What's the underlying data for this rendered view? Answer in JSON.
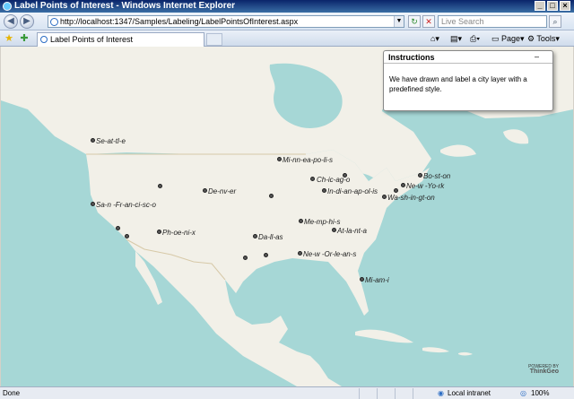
{
  "window": {
    "title": "Label Points of Interest - Windows Internet Explorer"
  },
  "address": {
    "url": "http://localhost:1347/Samples/Labeling/LabelPointsOfInterest.aspx"
  },
  "search": {
    "placeholder": "Live Search"
  },
  "tab": {
    "label": "Label Points of Interest"
  },
  "commands": {
    "page": "Page",
    "tools": "Tools"
  },
  "instructions": {
    "title": "Instructions",
    "minimize": "–",
    "body": "We have drawn and label a city layer with a predefined style."
  },
  "cities": [
    {
      "label": "Se-at-tl-e"
    },
    {
      "label": "Mi-nn-ea-po-li-s"
    },
    {
      "label": "Ch-ic-ag-o"
    },
    {
      "label": "Bo-st-on"
    },
    {
      "label": "Ne-w -Yo-rk"
    },
    {
      "label": "Wa-sh-in-gt-on"
    },
    {
      "label": "De-nv-er"
    },
    {
      "label": "In-di-an-ap-ol-is"
    },
    {
      "label": "Sa-n -Fr-an-ci-sc-o"
    },
    {
      "label": "Me-mp-hi-s"
    },
    {
      "label": "At-la-nt-a"
    },
    {
      "label": "Ph-oe-ni-x"
    },
    {
      "label": "Da-ll-as"
    },
    {
      "label": "Ne-w -Or-le-an-s"
    },
    {
      "label": "Mi-am-i"
    }
  ],
  "branding": {
    "powered_by": "POWERED BY",
    "company": "ThinkGeo"
  },
  "statusbar": {
    "left": "Done",
    "zone": "Local intranet",
    "zoom": "100%"
  },
  "colors": {
    "water": "#a6d7d6",
    "land": "#f2f0e8",
    "titlebar": "#0a246a"
  }
}
